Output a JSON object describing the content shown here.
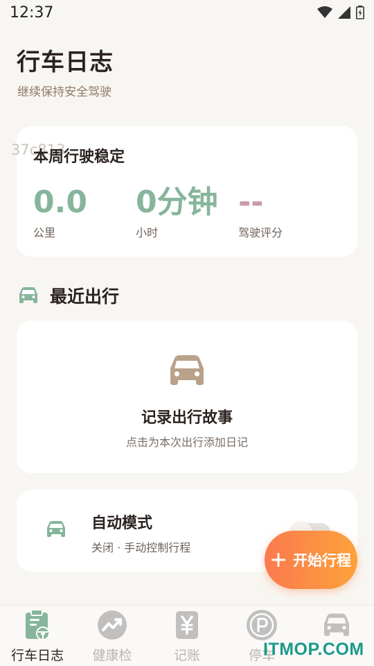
{
  "status_bar": {
    "time": "12:37"
  },
  "header": {
    "title": "行车日志",
    "subtitle": "继续保持安全驾驶"
  },
  "week_card": {
    "watermark": "37c813",
    "title": "本周行驶稳定",
    "stats": [
      {
        "value": "0.0",
        "label": "公里"
      },
      {
        "value": "0分钟",
        "label": "小时"
      },
      {
        "value": "--",
        "label": "驾驶评分"
      }
    ]
  },
  "recent": {
    "icon": "car-icon",
    "title": "最近出行",
    "empty_title": "记录出行故事",
    "empty_subtitle": "点击为本次出行添加日记"
  },
  "auto_mode": {
    "title": "自动模式",
    "subtitle": "关闭 · 手动控制行程",
    "enabled": false
  },
  "fab": {
    "label": "开始行程"
  },
  "bottom_nav": [
    {
      "label": "行车日志",
      "icon": "clipboard-wheel-icon",
      "active": true
    },
    {
      "label": "健康检",
      "icon": "trend-icon",
      "active": false
    },
    {
      "label": "记账",
      "icon": "yen-icon",
      "active": false
    },
    {
      "label": "停车",
      "icon": "parking-icon",
      "active": false
    },
    {
      "label": "",
      "icon": "car-icon",
      "active": false
    }
  ],
  "watermark": "ITMOP.COM",
  "colors": {
    "accent_green": "#86b59b",
    "score_pink": "#c99aab",
    "car_brown": "#b9a18a",
    "fab_start": "#fb7a4e",
    "fab_end": "#fca23c",
    "background": "#f8f6f2"
  }
}
